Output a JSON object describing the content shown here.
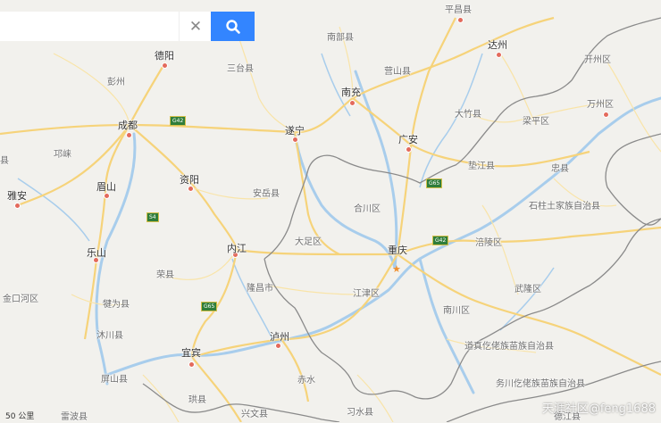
{
  "search": {
    "value": "",
    "placeholder": ""
  },
  "colors": {
    "land": "#f2f1ed",
    "river": "#a8cdec",
    "expressway": "#f6d37a",
    "road": "#f9e4a8",
    "border": "#8a8a8a",
    "search_button": "#3385ff"
  },
  "icons": {
    "clear": "close-icon",
    "search": "search-icon",
    "capital": "star-icon"
  },
  "places": {
    "pingchang": "平昌县",
    "nanbu": "南部县",
    "deyang": "德阳",
    "santai": "三台县",
    "yingshan": "营山县",
    "dazhou": "达州",
    "kaizhou": "开州区",
    "pengzhou": "彭州",
    "nanchong": "南充",
    "wanzhou": "万州区",
    "chengdu": "成都",
    "suining": "遂宁",
    "dazhu": "大竹县",
    "liangping": "梁平区",
    "guangan": "广安",
    "qionglai": "邛崃",
    "dianjiang": "垫江县",
    "zhongxian": "忠县",
    "meishan": "眉山",
    "ziyang": "资阳",
    "anyue": "安岳县",
    "yaan": "雅安",
    "hechuan": "合川区",
    "shizhu": "石柱土家族自治县",
    "dazu": "大足区",
    "neijiang": "内江",
    "fuling": "涪陵区",
    "leshan": "乐山",
    "chongqing": "重庆",
    "rongxian": "荣县",
    "longchang": "隆昌市",
    "jiangjin": "江津区",
    "wulong": "武隆区",
    "jinkouhe": "金口河区",
    "qianwei": "犍为县",
    "nanchuan": "南川区",
    "muchuan": "沐川县",
    "luzhou": "泸州",
    "daozhen": "道真仡佬族苗族自治县",
    "yibin": "宜宾",
    "pingshan": "屏山县",
    "chishui": "赤水",
    "wuchuan": "务川仡佬族苗族自治县",
    "junlian": "珙县",
    "leibo": "雷波县",
    "xingwen": "兴文县",
    "xishui": "习水县",
    "dejiang": "德江县",
    "yi": "县"
  },
  "shields": {
    "g42_west": "G42",
    "g42_east": "G42",
    "g65_north": "G65",
    "g65_south": "G65",
    "s4": "S4"
  },
  "scale": {
    "text": "50 公里"
  },
  "watermark": {
    "text": "天涯社区@feng1688"
  }
}
